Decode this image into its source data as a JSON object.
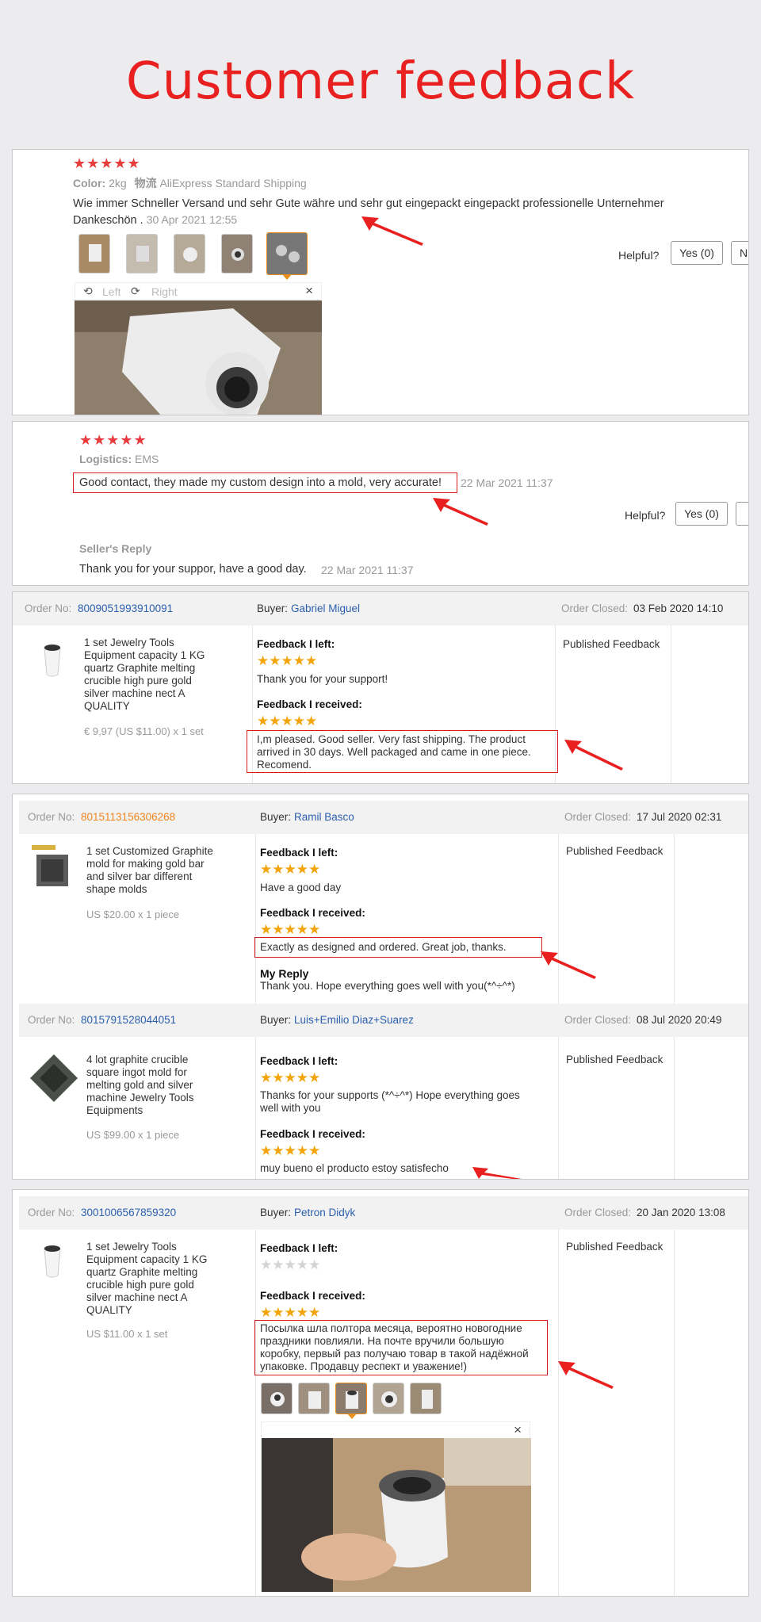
{
  "page": {
    "title": "Customer feedback"
  },
  "review1": {
    "color_label": "Color:",
    "color_value": "2kg",
    "shipping_label": "物流",
    "shipping_value": "AliExpress Standard Shipping",
    "text_line1": "Wie immer Schneller Versand und sehr Gute währe und sehr gut eingepackt eingepackt professionelle Unternehmer",
    "text_line2": "Dankeschön .",
    "date": "30 Apr 2021 12:55",
    "rotate_left": "Left",
    "rotate_right": "Right",
    "close": "×",
    "helpful_label": "Helpful?",
    "yes_label": "Yes (0)",
    "no_label": "N"
  },
  "review2": {
    "logistics_label": "Logistics:",
    "logistics_value": "EMS",
    "text": "Good contact, they made my custom design into a mold, very accurate!",
    "date": "22 Mar 2021 11:37",
    "helpful_label": "Helpful?",
    "yes_label": "Yes (0)",
    "seller_reply_label": "Seller's Reply",
    "seller_reply_text": "Thank you for your suppor, have a good day.",
    "seller_reply_date": "22 Mar 2021 11:37"
  },
  "labels": {
    "order_no": "Order No:",
    "buyer": "Buyer:",
    "order_closed": "Order Closed:",
    "feedback_left": "Feedback I left:",
    "feedback_received": "Feedback I received:",
    "published": "Published Feedback",
    "my_reply": "My Reply"
  },
  "orders": [
    {
      "order_no": "8009051993910091",
      "buyer": "Gabriel Miguel",
      "closed": "03 Feb 2020 14:10",
      "product": [
        "1 set Jewelry Tools",
        "Equipment capacity 1 KG",
        "quartz Graphite melting",
        "crucible high pure gold",
        "silver machine nect A",
        "QUALITY"
      ],
      "price": "€ 9,97 (US $11.00) x 1 set",
      "left_text": "Thank you for your support!",
      "received_text": [
        "I,m pleased. Good seller. Very fast shipping. The product",
        "arrived in 30 days. Well packaged and came in one piece.",
        "Recomend."
      ]
    },
    {
      "order_no": "8015113156306268",
      "buyer": "Ramil Basco",
      "closed": "17 Jul 2020 02:31",
      "product": [
        "1 set Customized Graphite",
        "mold for making gold bar",
        "and silver bar different",
        "shape molds"
      ],
      "price": "US $20.00 x 1 piece",
      "left_text": "Have a good day",
      "received_text": "Exactly as designed and ordered. Great job, thanks.",
      "reply_text": "Thank you. Hope everything goes well with you(*^÷^*)"
    },
    {
      "order_no": "8015791528044051",
      "buyer": "Luis+Emilio Diaz+Suarez",
      "closed": "08 Jul 2020 20:49",
      "product": [
        "4 lot graphite crucible",
        "square ingot mold for",
        "melting gold and silver",
        "machine Jewelry Tools",
        "Equipments"
      ],
      "price": "US $99.00 x 1 piece",
      "left_text": [
        "Thanks for your supports (*^÷^*) Hope everything goes",
        "well with you"
      ],
      "received_text": "muy bueno el producto estoy satisfecho"
    },
    {
      "order_no": "3001006567859320",
      "buyer": "Petron Didyk",
      "closed": "20 Jan 2020 13:08",
      "product": [
        "1 set Jewelry Tools",
        "Equipment capacity 1 KG",
        "quartz Graphite melting",
        "crucible high pure gold",
        "silver machine nect A",
        "QUALITY"
      ],
      "price": "US $11.00 x 1 set",
      "received_text": [
        "Посылка шла полтора месяца, вероятно новогодние",
        "праздники повлияли. На почте вручили большую",
        "коробку, первый раз получаю товар в такой надёжной",
        "упаковке. Продавцу респект и уважение!)"
      ],
      "close": "×"
    }
  ],
  "colors": {
    "accent_red": "#e8201f",
    "star_red": "#e83c3c",
    "star_orange": "#f2a40a",
    "link_blue": "#2b5fae"
  }
}
